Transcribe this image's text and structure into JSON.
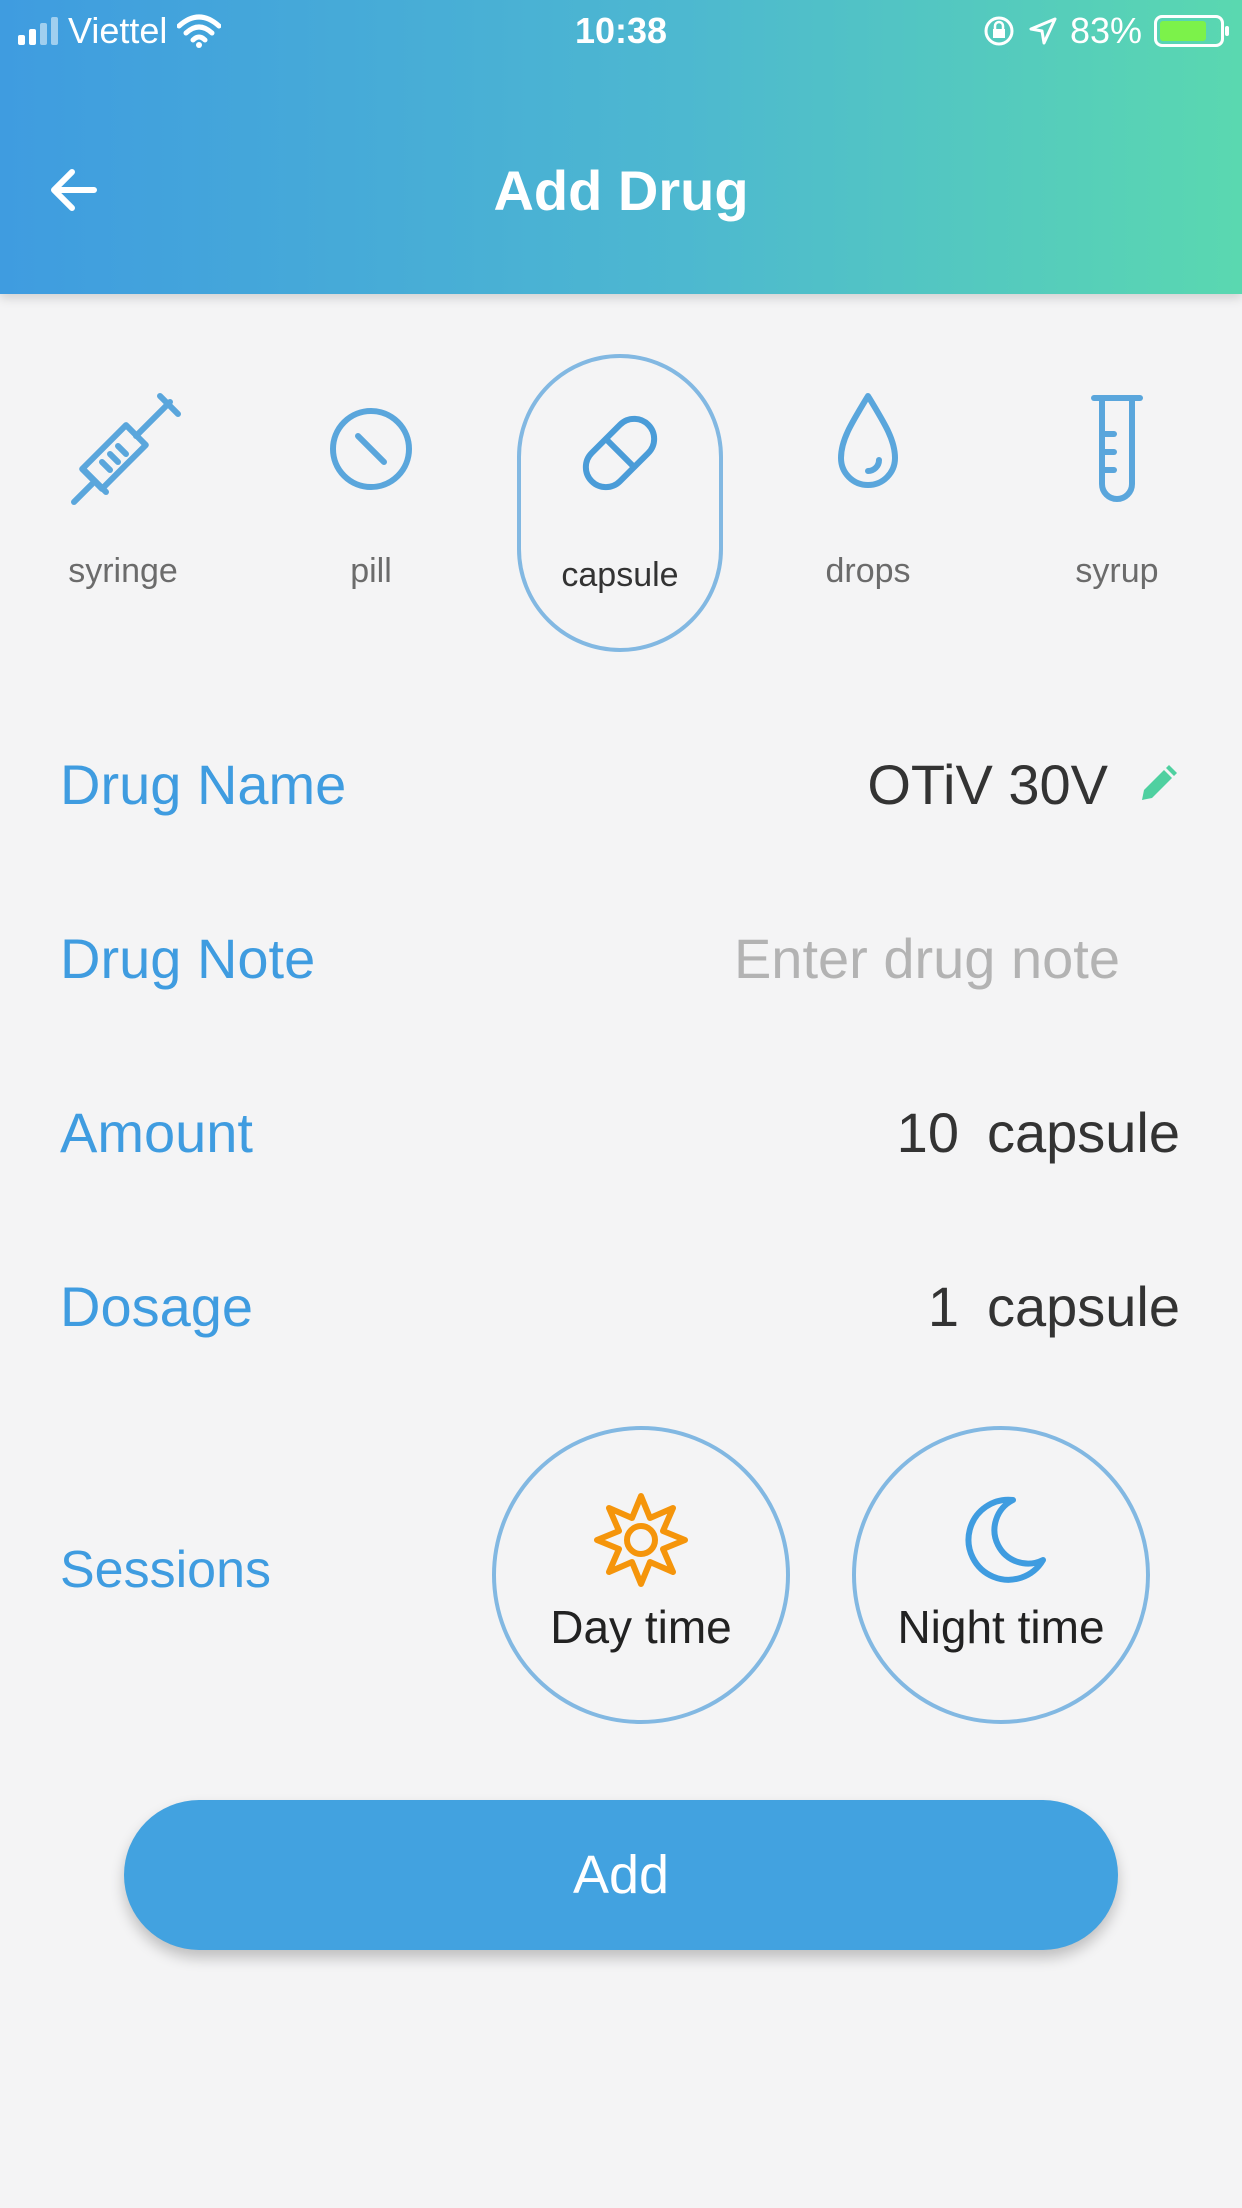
{
  "status_bar": {
    "carrier": "Viettel",
    "time": "10:38",
    "battery": "83%"
  },
  "header": {
    "title": "Add Drug"
  },
  "drug_types": [
    {
      "label": "syringe",
      "icon": "syringe-icon",
      "selected": false
    },
    {
      "label": "pill",
      "icon": "pill-icon",
      "selected": false
    },
    {
      "label": "capsule",
      "icon": "capsule-icon",
      "selected": true
    },
    {
      "label": "drops",
      "icon": "drops-icon",
      "selected": false
    },
    {
      "label": "syrup",
      "icon": "syrup-icon",
      "selected": false
    }
  ],
  "form": {
    "drug_name_label": "Drug Name",
    "drug_name_value": "OTiV 30V",
    "drug_note_label": "Drug Note",
    "drug_note_placeholder": "Enter drug note",
    "amount_label": "Amount",
    "amount_value": "10",
    "amount_unit": "capsule",
    "dosage_label": "Dosage",
    "dosage_value": "1",
    "dosage_unit": "capsule",
    "sessions_label": "Sessions",
    "sessions": [
      {
        "label": "Day time",
        "icon": "sun-icon"
      },
      {
        "label": "Night time",
        "icon": "moon-icon"
      }
    ]
  },
  "add_button": {
    "label": "Add"
  },
  "colors": {
    "accent": "#3f9ce0",
    "icon_blue": "#5aa6dc",
    "sun": "#f5950b",
    "edit": "#4fd0a0"
  }
}
